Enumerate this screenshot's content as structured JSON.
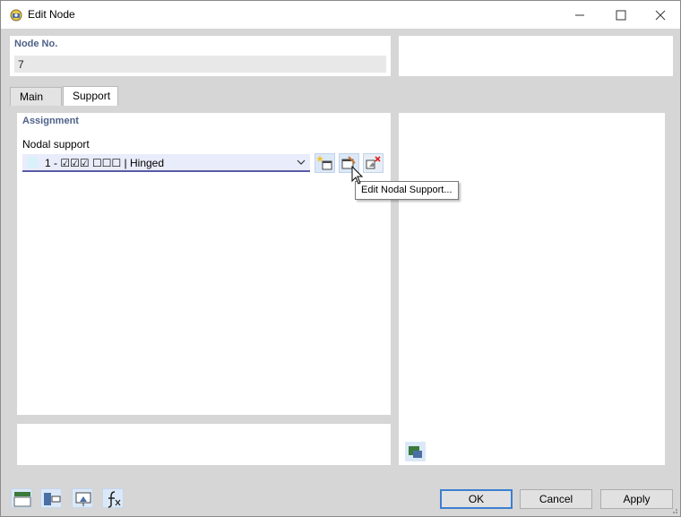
{
  "window": {
    "title": "Edit Node"
  },
  "node": {
    "label": "Node No.",
    "value": "7"
  },
  "tabs": [
    {
      "label": "Main",
      "active": false
    },
    {
      "label": "Support",
      "active": true
    }
  ],
  "assignment": {
    "section_title": "Assignment",
    "nodal_support_label": "Nodal support",
    "selected": "1 - ☑☑☑  ☐☐☐ | Hinged",
    "swatch_color": "#d8f1fb"
  },
  "toolbar_buttons": [
    {
      "name": "new-nodal-support-icon"
    },
    {
      "name": "edit-nodal-support-icon"
    },
    {
      "name": "delete-nodal-support-icon"
    }
  ],
  "tooltip": {
    "text": "Edit Nodal Support..."
  },
  "footer": {
    "ok_label": "OK",
    "cancel_label": "Cancel",
    "apply_label": "Apply"
  },
  "colors": {
    "section_title": "#4f6289",
    "accent": "#3c7fd0",
    "combo_bg": "#e9ecfa"
  }
}
